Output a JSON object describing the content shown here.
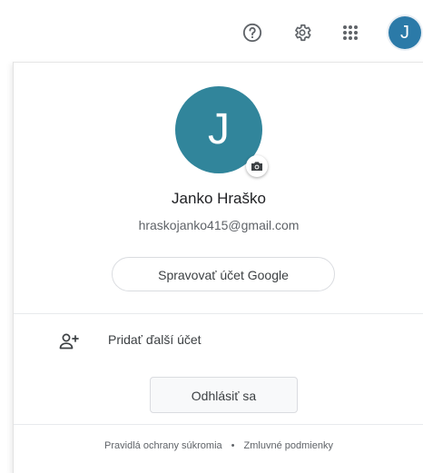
{
  "topbar": {
    "help_icon": "help-circle-icon",
    "settings_icon": "gear-icon",
    "apps_icon": "apps-grid-icon",
    "avatar_letter": "J"
  },
  "account": {
    "avatar_letter": "J",
    "camera_icon": "camera-icon",
    "name": "Janko Hraško",
    "email": "hraskojanko415@gmail.com",
    "manage_label": "Spravovať účet Google"
  },
  "actions": {
    "add_account_icon": "add-person-icon",
    "add_account_label": "Pridať ďalší účet",
    "sign_out_label": "Odhlásiť sa"
  },
  "footer": {
    "privacy_label": "Pravidlá ochrany súkromia",
    "separator": "•",
    "terms_label": "Zmluvné podmienky"
  },
  "colors": {
    "avatar_small": "#2b7aa8",
    "avatar_large": "#31859b",
    "text_primary": "#202124",
    "text_secondary": "#5f6368"
  }
}
